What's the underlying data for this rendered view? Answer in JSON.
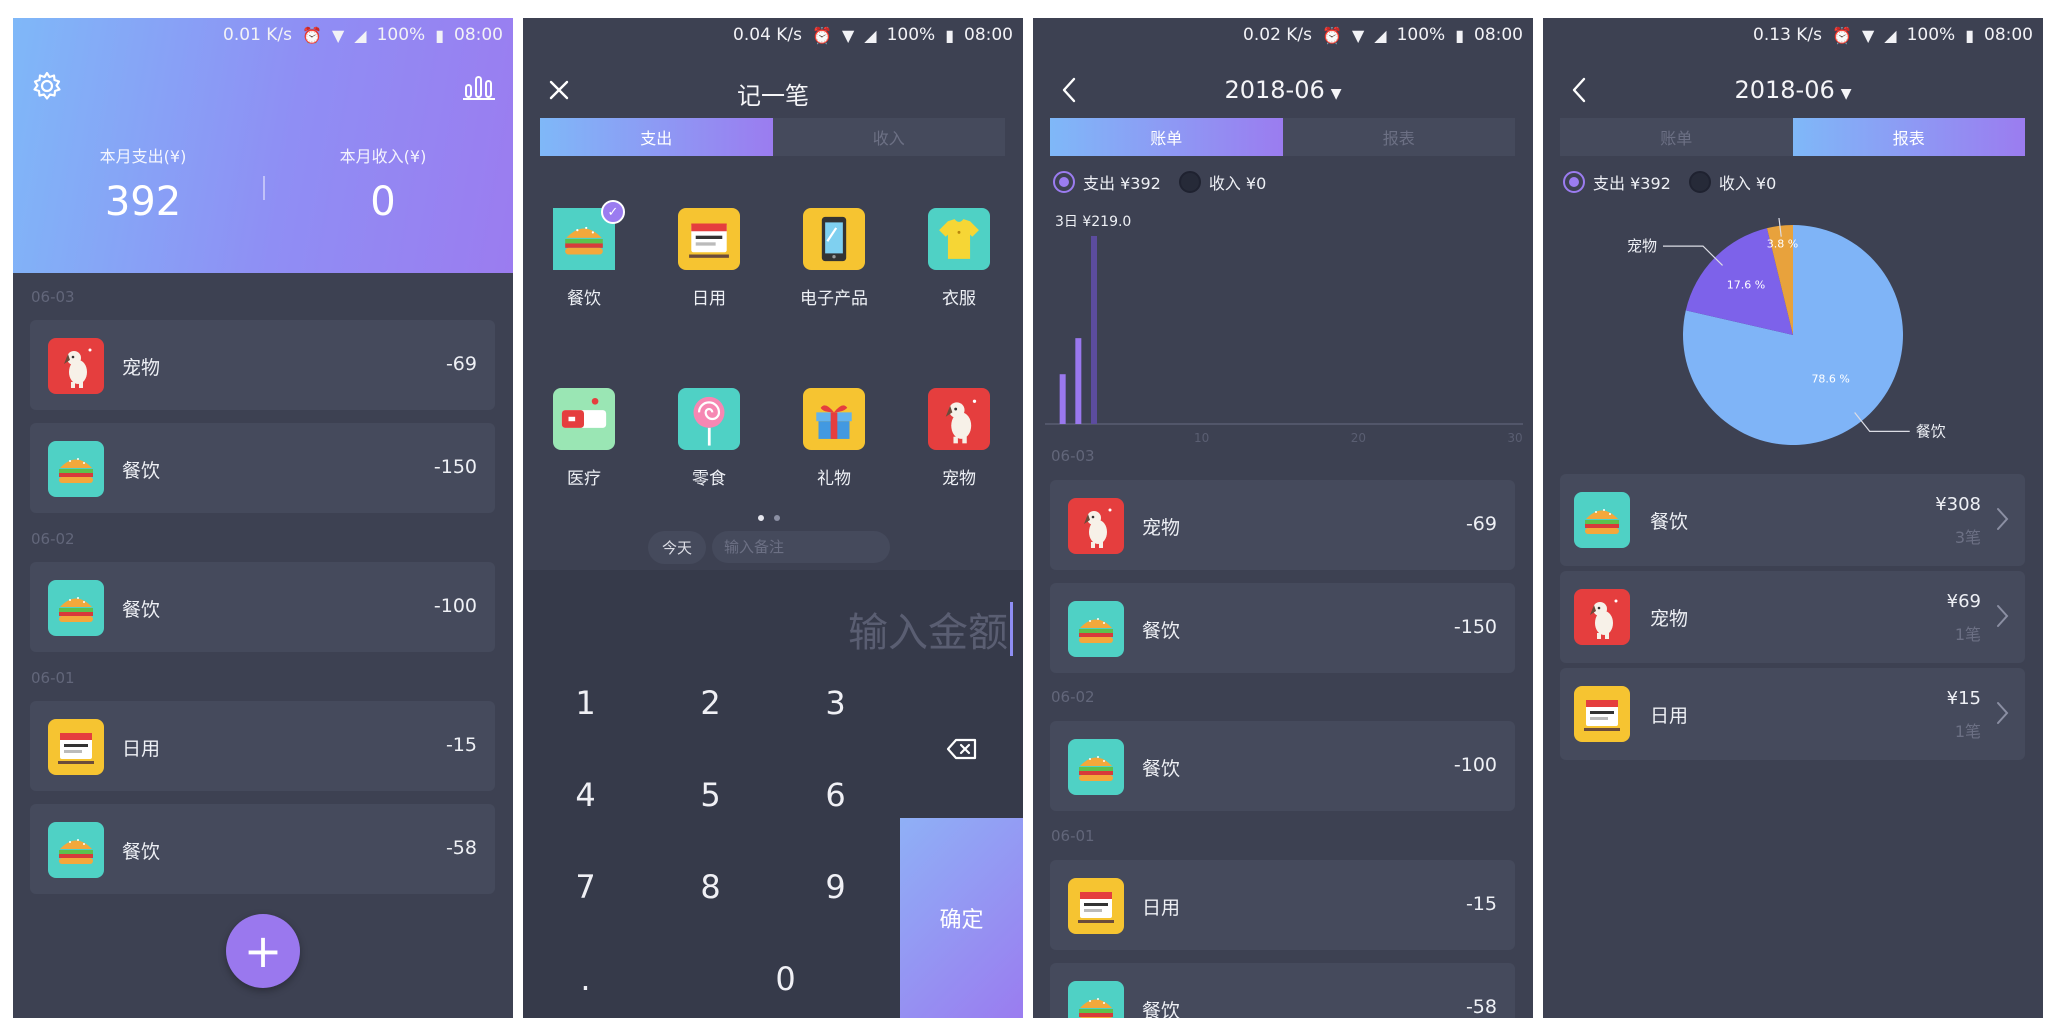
{
  "status": {
    "s1_speed": "0.01 K/s",
    "s2_speed": "0.04 K/s",
    "s3_speed": "0.02 K/s",
    "s4_speed": "0.13 K/s",
    "battery": "100%",
    "time": "08:00"
  },
  "home": {
    "expense_label": "本月支出(¥)",
    "expense_value": "392",
    "income_label": "本月收入(¥)",
    "income_value": "0",
    "groups": [
      {
        "date": "06-03",
        "items": [
          {
            "name": "宠物",
            "amount": "-69",
            "icon": "pet-icon"
          },
          {
            "name": "餐饮",
            "amount": "-150",
            "icon": "burger-icon"
          }
        ]
      },
      {
        "date": "06-02",
        "items": [
          {
            "name": "餐饮",
            "amount": "-100",
            "icon": "burger-icon"
          }
        ]
      },
      {
        "date": "06-01",
        "items": [
          {
            "name": "日用",
            "amount": "-15",
            "icon": "daily-icon"
          },
          {
            "name": "餐饮",
            "amount": "-58",
            "icon": "burger-icon"
          }
        ]
      }
    ],
    "fab": "+"
  },
  "add": {
    "title": "记一笔",
    "tab_expense": "支出",
    "tab_income": "收入",
    "categories": [
      {
        "name": "餐饮",
        "icon": "burger-icon",
        "selected": true
      },
      {
        "name": "日用",
        "icon": "daily-icon"
      },
      {
        "name": "电子产品",
        "icon": "phone-icon"
      },
      {
        "name": "衣服",
        "icon": "shirt-icon"
      },
      {
        "name": "医疗",
        "icon": "medical-icon"
      },
      {
        "name": "零食",
        "icon": "lollipop-icon"
      },
      {
        "name": "礼物",
        "icon": "gift-icon"
      },
      {
        "name": "宠物",
        "icon": "pet-icon"
      }
    ],
    "today": "今天",
    "note_placeholder": "输入备注",
    "amount_placeholder": "输入金额",
    "keys": [
      "1",
      "2",
      "3",
      "4",
      "5",
      "6",
      "7",
      "8",
      "9",
      ".",
      "0"
    ],
    "confirm": "确定"
  },
  "bills": {
    "month": "2018-06",
    "tab_bill": "账单",
    "tab_report": "报表",
    "radio_expense": "支出 ¥392",
    "radio_income": "收入 ¥0",
    "groups": [
      {
        "date": "06-03",
        "items": [
          {
            "name": "宠物",
            "amount": "-69"
          },
          {
            "name": "餐饮",
            "amount": "-150"
          }
        ]
      },
      {
        "date": "06-02",
        "items": [
          {
            "name": "餐饮",
            "amount": "-100"
          }
        ]
      },
      {
        "date": "06-01",
        "items": [
          {
            "name": "日用",
            "amount": "-15"
          },
          {
            "name": "餐饮",
            "amount": "-58"
          }
        ]
      }
    ]
  },
  "report": {
    "month": "2018-06",
    "tab_bill": "账单",
    "tab_report": "报表",
    "radio_expense": "支出 ¥392",
    "radio_income": "收入 ¥0",
    "rows": [
      {
        "name": "餐饮",
        "amount": "¥308",
        "count": "3笔"
      },
      {
        "name": "宠物",
        "amount": "¥69",
        "count": "1笔"
      },
      {
        "name": "日用",
        "amount": "¥15",
        "count": "1笔"
      }
    ]
  },
  "chart_data": [
    {
      "type": "bar",
      "x": [
        1,
        2,
        3
      ],
      "values": [
        58,
        100,
        219
      ],
      "annotation": "3日 ¥219.0",
      "xticks": [
        "10",
        "20",
        "30"
      ],
      "xlim": [
        0,
        30
      ],
      "colors": [
        "#9a78ee"
      ]
    },
    {
      "type": "pie",
      "categories": [
        "餐饮",
        "宠物",
        "日用"
      ],
      "values": [
        78.6,
        17.6,
        3.8
      ],
      "value_labels": [
        "78.6 %",
        "17.6 %",
        "3.8 %"
      ],
      "colors": [
        "#7fb4f7",
        "#7d62ea",
        "#e8a23c"
      ]
    }
  ]
}
